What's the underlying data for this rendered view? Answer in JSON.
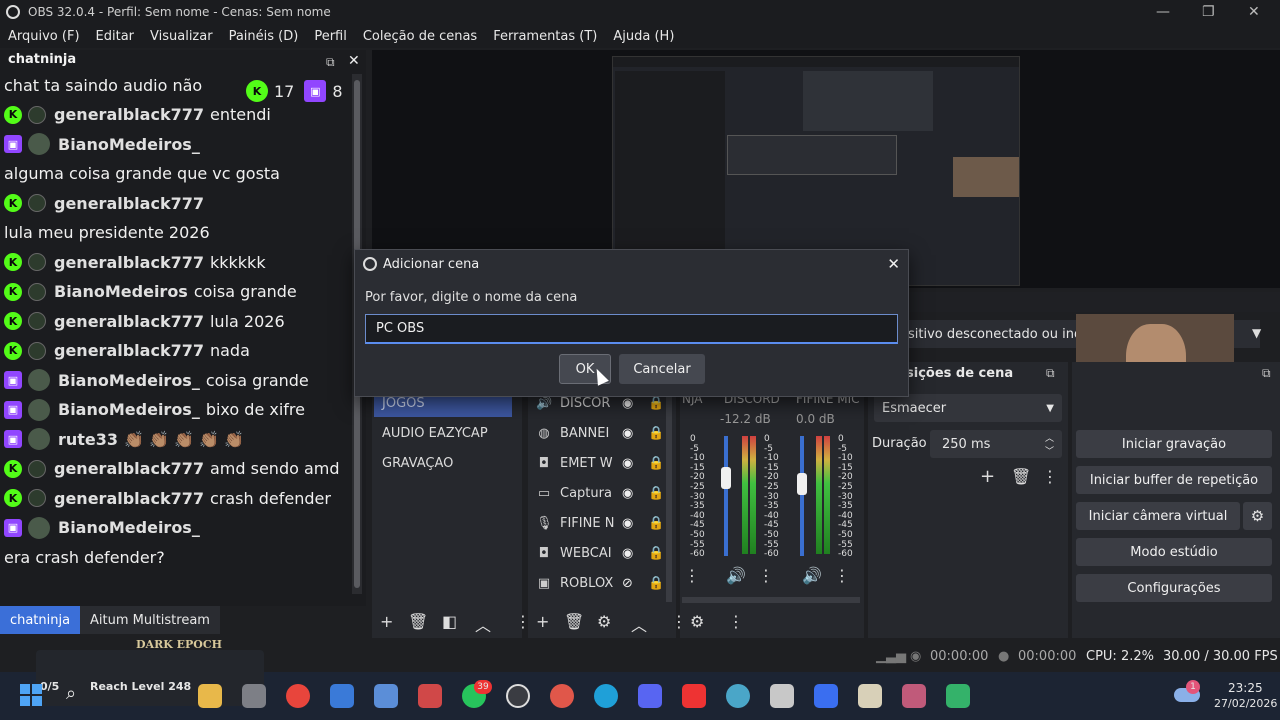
{
  "window": {
    "title": "OBS 32.0.4 - Perfil: Sem nome - Cenas: Sem nome"
  },
  "menu": [
    "Arquivo (F)",
    "Editar",
    "Visualizar",
    "Painéis (D)",
    "Perfil",
    "Coleção de cenas",
    "Ferramentas (T)",
    "Ajuda (H)"
  ],
  "chat": {
    "title": "chatninja",
    "kick_count": "17",
    "twitch_count": "8",
    "lines": [
      {
        "platform": "",
        "user": "",
        "message": "chat ta saindo audio não"
      },
      {
        "platform": "kick",
        "user": "generalblack777",
        "message": "entendi"
      },
      {
        "platform": "twitch",
        "user": "BianoMedeiros_",
        "message": ""
      },
      {
        "platform": "",
        "user": "",
        "message": "alguma coisa grande que vc gosta"
      },
      {
        "platform": "kick",
        "user": "generalblack777",
        "message": ""
      },
      {
        "platform": "",
        "user": "",
        "message": "lula meu presidente 2026"
      },
      {
        "platform": "kick",
        "user": "generalblack777",
        "message": "kkkkkk"
      },
      {
        "platform": "kick",
        "user": "BianoMedeiros",
        "message": "coisa grande"
      },
      {
        "platform": "kick",
        "user": "generalblack777",
        "message": "lula 2026"
      },
      {
        "platform": "kick",
        "user": "generalblack777",
        "message": "nada"
      },
      {
        "platform": "twitch",
        "user": "BianoMedeiros_",
        "message": "coisa grande"
      },
      {
        "platform": "twitch",
        "user": "BianoMedeiros_",
        "message": "bixo de xifre"
      },
      {
        "platform": "twitch",
        "user": "rute33",
        "message": "👏🏽 👏🏽 👏🏽 👏🏽 👏🏽"
      },
      {
        "platform": "kick",
        "user": "generalblack777",
        "message": "amd sendo amd"
      },
      {
        "platform": "kick",
        "user": "generalblack777",
        "message": "crash defender"
      },
      {
        "platform": "twitch",
        "user": "BianoMedeiros_",
        "message": ""
      },
      {
        "platform": "",
        "user": "",
        "message": "era crash defender?"
      }
    ],
    "tabs": [
      "chatninja",
      "Aitum Multistream"
    ]
  },
  "preview": {
    "device_message": "sitivo desconectado ou indis"
  },
  "scenes": {
    "items": [
      "JOGOS",
      "AUDIO EAZYCAP",
      "GRAVAÇAO"
    ]
  },
  "sources": {
    "items": [
      "DISCOR",
      "BANNEI",
      "EMET W",
      "Captura",
      "FIFINE N",
      "WEBCAI",
      "ROBLOX"
    ],
    "icons": [
      "speaker-icon",
      "globe-icon",
      "camera-icon",
      "monitor-icon",
      "mic-icon",
      "camera-icon",
      "window-icon"
    ]
  },
  "mixer": {
    "channels": [
      {
        "name": "NJA",
        "db": ""
      },
      {
        "name": "DISCORD",
        "db": "-12.2 dB",
        "level": 0.72
      },
      {
        "name": "FIFINE MIC",
        "db": "0.0 dB",
        "level": 0.35
      }
    ],
    "scale": [
      "0",
      "-5",
      "-10",
      "-15",
      "-20",
      "-25",
      "-30",
      "-35",
      "-40",
      "-45",
      "-50",
      "-55",
      "-60"
    ]
  },
  "transitions": {
    "title": "sições de cena",
    "selected": "Esmaecer",
    "duration_label": "Duração",
    "duration_value": "250 ms"
  },
  "controls": {
    "buttons": [
      "Iniciar gravação",
      "Iniciar buffer de repetição",
      "Iniciar câmera virtual",
      "Modo estúdio",
      "Configurações"
    ]
  },
  "dialog": {
    "title": "Adicionar cena",
    "prompt": "Por favor, digite o nome da cena",
    "value": "PC OBS",
    "ok": "OK",
    "cancel": "Cancelar"
  },
  "status": {
    "rec_time": "00:00:00",
    "stream_time": "00:00:00",
    "cpu": "CPU: 2.2%",
    "fps": "30.00 / 30.00 FPS"
  },
  "taskbar": {
    "widget_progress": "0/5",
    "widget_text": "Reach Level 248",
    "game_logo": "DARK EPOCH",
    "time": "23:25",
    "date": "27/02/2026",
    "whatsapp_badge": "39",
    "notif_badge": "1"
  }
}
